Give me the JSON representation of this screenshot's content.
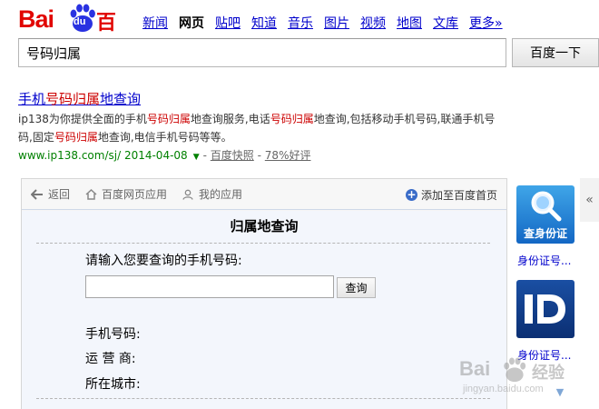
{
  "logo": {
    "latin": "Bai",
    "paw_text": "du",
    "cn": "百度"
  },
  "nav": [
    {
      "label": "新闻",
      "active": false
    },
    {
      "label": "网页",
      "active": true
    },
    {
      "label": "贴吧",
      "active": false
    },
    {
      "label": "知道",
      "active": false
    },
    {
      "label": "音乐",
      "active": false
    },
    {
      "label": "图片",
      "active": false
    },
    {
      "label": "视频",
      "active": false
    },
    {
      "label": "地图",
      "active": false
    },
    {
      "label": "文库",
      "active": false
    },
    {
      "label": "更多»",
      "active": false
    }
  ],
  "search": {
    "value": "号码归属",
    "button": "百度一下"
  },
  "result": {
    "title_a": "手机",
    "title_b": "号码归属",
    "title_c": "地查询",
    "abs": [
      {
        "t": "ip138为你提供全面的手机",
        "hl": false
      },
      {
        "t": "号码归属",
        "hl": true
      },
      {
        "t": "地查询服务,电话",
        "hl": false
      },
      {
        "t": "号码归属",
        "hl": true
      },
      {
        "t": "地查询,包括移动手机号码,联通手机号码,固定",
        "hl": false
      },
      {
        "t": "号码归属",
        "hl": true
      },
      {
        "t": "地查询,电信手机号码等等。",
        "hl": false
      }
    ],
    "url": "www.ip138.com/sj/ 2014-04-08",
    "sep": "-",
    "cache": "百度快照",
    "sep2": "-",
    "rating": "78%好评"
  },
  "app": {
    "back": "返回",
    "apps": "百度网页应用",
    "mine": "我的应用",
    "add_home": "添加至百度首页",
    "heading": "归属地查询",
    "prompt": "请输入您要查询的手机号码:",
    "query_btn": "查询",
    "fields": [
      "手机号码:",
      "运 营 商:",
      "所在城市:"
    ]
  },
  "sidebar": {
    "tile1_label": "查身份证",
    "link1": "身份证号...",
    "link2": "身份证号...",
    "collapse": "«"
  },
  "watermark": {
    "bai": "Bai",
    "cn": "经验",
    "url": "jingyan.baidu.com"
  }
}
